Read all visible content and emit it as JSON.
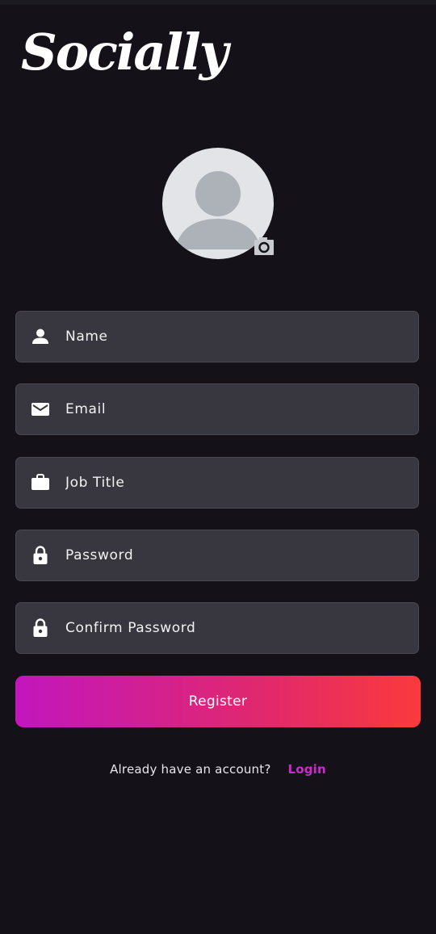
{
  "app": {
    "logo_text": "Socially"
  },
  "avatar": {
    "icon": "person-silhouette-icon",
    "camera_icon": "camera-icon"
  },
  "form": {
    "fields": [
      {
        "icon": "person-icon",
        "placeholder": "Name",
        "value": ""
      },
      {
        "icon": "email-icon",
        "placeholder": "Email",
        "value": ""
      },
      {
        "icon": "briefcase-icon",
        "placeholder": "Job Title",
        "value": ""
      },
      {
        "icon": "lock-icon",
        "placeholder": "Password",
        "value": ""
      },
      {
        "icon": "lock-icon",
        "placeholder": "Confirm Password",
        "value": ""
      }
    ],
    "register_label": "Register"
  },
  "footer": {
    "prompt": "Already have an account?",
    "login_label": "Login"
  },
  "colors": {
    "background": "#141218",
    "field_bg": "#38363e",
    "accent": "#c92ccd",
    "gradient_start": "#c216be",
    "gradient_end": "#fa3a3c"
  }
}
